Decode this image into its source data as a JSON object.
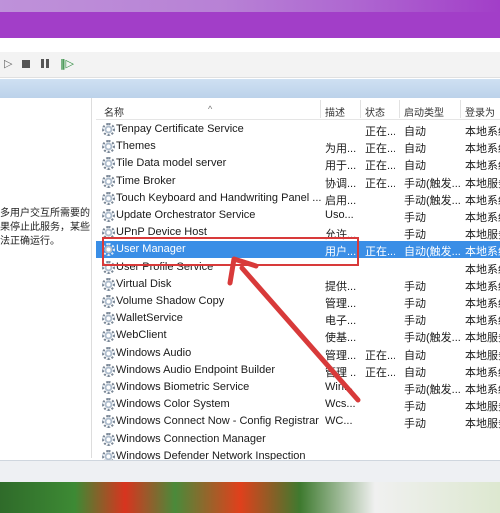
{
  "columns": {
    "name": "名称",
    "desc": "描述",
    "status": "状态",
    "startup": "启动类型",
    "logon": "登录为"
  },
  "description_text": "多用户交互所需要的\n果停止此服务，某些\n法正确运行。",
  "services": [
    {
      "name": "Tenpay Certificate Service",
      "desc": "",
      "status": "正在...",
      "startup": "自动",
      "logon": "本地系统"
    },
    {
      "name": "Themes",
      "desc": "为用...",
      "status": "正在...",
      "startup": "自动",
      "logon": "本地系统"
    },
    {
      "name": "Tile Data model server",
      "desc": "用于...",
      "status": "正在...",
      "startup": "自动",
      "logon": "本地系统"
    },
    {
      "name": "Time Broker",
      "desc": "协调...",
      "status": "正在...",
      "startup": "手动(触发...",
      "logon": "本地服务"
    },
    {
      "name": "Touch Keyboard and Handwriting Panel ...",
      "desc": "启用...",
      "status": "",
      "startup": "手动(触发...",
      "logon": "本地系统"
    },
    {
      "name": "Update Orchestrator Service",
      "desc": "Uso...",
      "status": "",
      "startup": "手动",
      "logon": "本地系统"
    },
    {
      "name": "UPnP Device Host",
      "desc": "允许...",
      "status": "",
      "startup": "手动",
      "logon": "本地服务"
    },
    {
      "name": "User Manager",
      "desc": "用户...",
      "status": "正在...",
      "startup": "自动(触发...",
      "logon": "本地系统"
    },
    {
      "name": "User Profile Service",
      "desc": "",
      "status": "",
      "startup": "",
      "logon": "本地系统"
    },
    {
      "name": "Virtual Disk",
      "desc": "提供...",
      "status": "",
      "startup": "手动",
      "logon": "本地系统"
    },
    {
      "name": "Volume Shadow Copy",
      "desc": "管理...",
      "status": "",
      "startup": "手动",
      "logon": "本地系统"
    },
    {
      "name": "WalletService",
      "desc": "电子...",
      "status": "",
      "startup": "手动",
      "logon": "本地系统"
    },
    {
      "name": "WebClient",
      "desc": "使基...",
      "status": "",
      "startup": "手动(触发...",
      "logon": "本地服务"
    },
    {
      "name": "Windows Audio",
      "desc": "管理...",
      "status": "正在...",
      "startup": "自动",
      "logon": "本地服务"
    },
    {
      "name": "Windows Audio Endpoint Builder",
      "desc": "管理 ...",
      "status": "正在...",
      "startup": "自动",
      "logon": "本地系统"
    },
    {
      "name": "Windows Biometric Service",
      "desc": "Win...",
      "status": "",
      "startup": "手动(触发...",
      "logon": "本地系统"
    },
    {
      "name": "Windows Color System",
      "desc": "Wcs...",
      "status": "",
      "startup": "手动",
      "logon": "本地服务"
    },
    {
      "name": "Windows Connect Now - Config Registrar",
      "desc": "WC...",
      "status": "",
      "startup": "手动",
      "logon": "本地服务"
    },
    {
      "name": "Windows Connection Manager",
      "desc": "",
      "status": "",
      "startup": "",
      "logon": ""
    },
    {
      "name": "Windows Defender Network Inspection",
      "desc": "",
      "status": "",
      "startup": "",
      "logon": ""
    }
  ],
  "selected_index": 7,
  "colors": {
    "selection": "#3a8ee6",
    "annotation": "#d83a3a",
    "top_band": "#a23ec8"
  }
}
